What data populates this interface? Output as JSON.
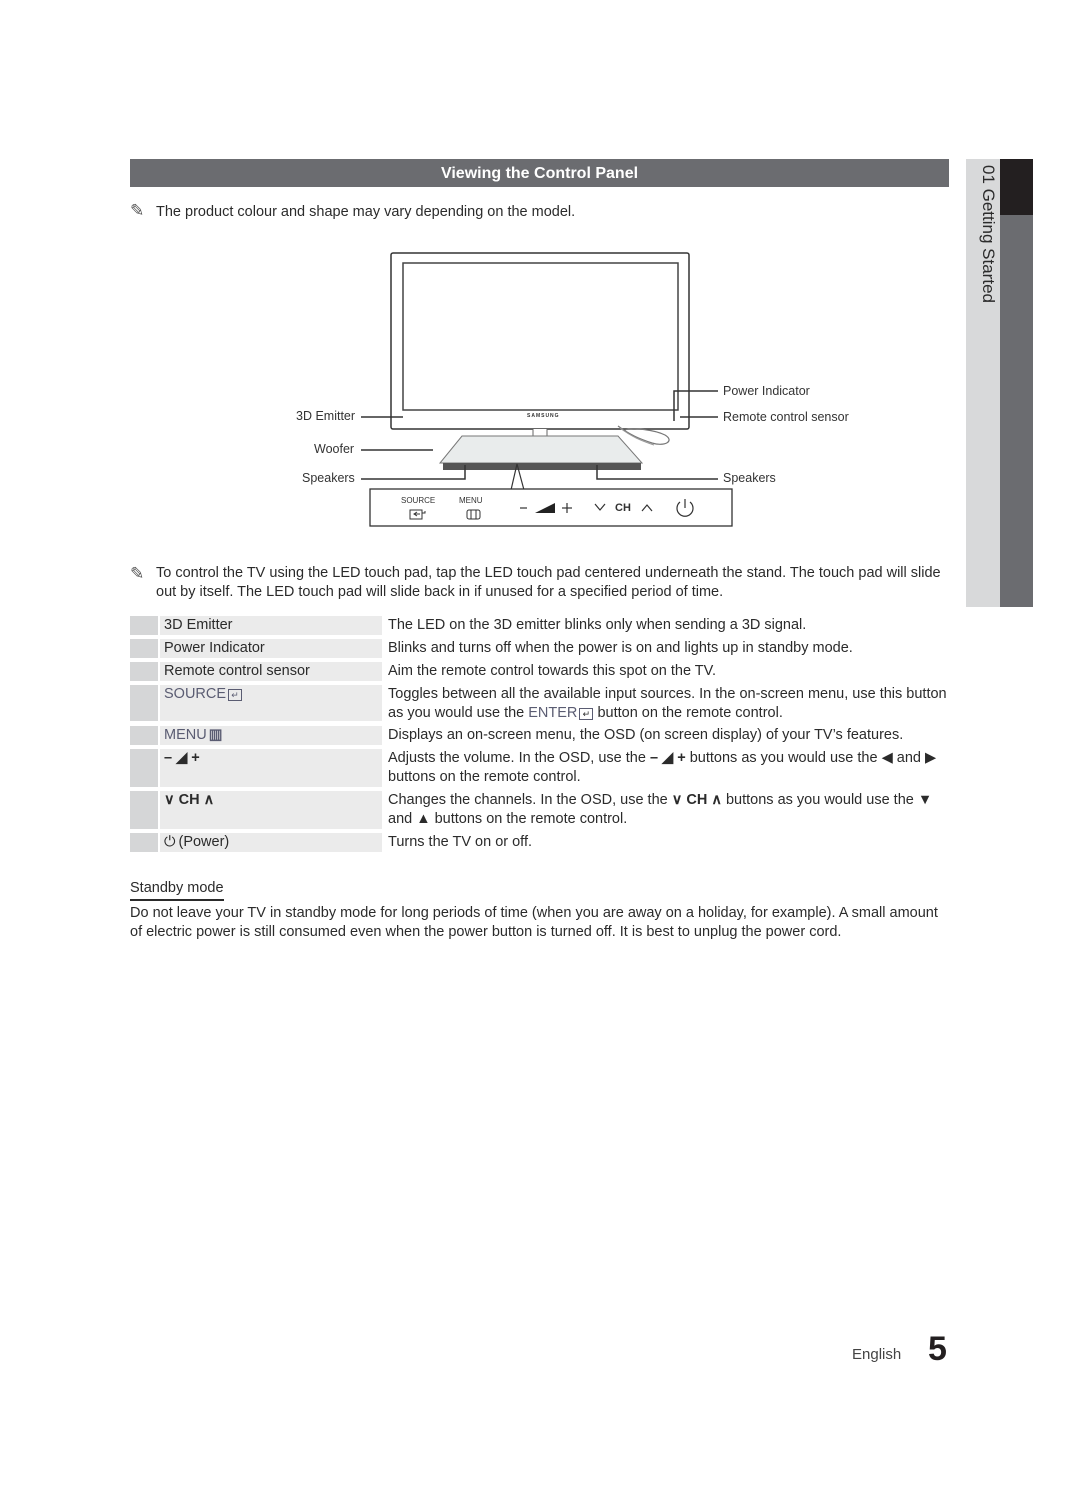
{
  "section": {
    "title": "Viewing the Control Panel"
  },
  "notes": {
    "colour_note": "The product colour and shape may vary depending on the model.",
    "touch_pad_note": "To control the TV using the LED touch pad, tap the LED touch pad centered underneath the stand. The touch pad will slide out by itself. The LED touch pad will slide back in if unused for a specified period of time.",
    "note_icon": "pencil-note-icon"
  },
  "diagram": {
    "labels": {
      "emitter_3d": "3D Emitter",
      "woofer": "Woofer",
      "speakers_left": "Speakers",
      "power_indicator": "Power Indicator",
      "remote_sensor": "Remote control sensor",
      "speakers_right": "Speakers",
      "brand": "SAMSUNG"
    },
    "touch_pad": {
      "source_label": "SOURCE",
      "menu_label": "MENU",
      "ch_label": "CH",
      "minus": "−",
      "plus": "+",
      "down": "∨",
      "up": "∧"
    }
  },
  "controls": [
    {
      "name": "3D Emitter",
      "description": "The LED on the 3D emitter blinks only when sending a 3D signal."
    },
    {
      "name": "Power Indicator",
      "description": "Blinks and turns off when the power is on and lights up in standby mode."
    },
    {
      "name": "Remote control sensor",
      "description": "Aim the remote control towards this spot on the TV."
    },
    {
      "name": "SOURCE",
      "description_a": "Toggles between all the available input sources. In the on-screen menu, use this button as you would use the ",
      "description_kw": "ENTER",
      "description_b": " button on the remote control."
    },
    {
      "name": "MENU",
      "description": "Displays an on-screen menu, the OSD (on screen display) of your TV’s features."
    },
    {
      "name": "– ◢ +",
      "description_a": "Adjusts the volume. In the OSD, use the ",
      "description_glyph": "– ◢ +",
      "description_b": " buttons as you would use the ◀ and ▶ buttons on the remote control."
    },
    {
      "name": "∨ CH ∧",
      "description_a": "Changes the channels. In the OSD, use the ",
      "description_glyph": "∨ CH ∧",
      "description_b": " buttons as you would use the ▼ and ▲ buttons on the remote control."
    },
    {
      "name": "(Power)",
      "description": "Turns the TV on or off."
    }
  ],
  "standby": {
    "title": "Standby mode",
    "body": "Do not leave your TV in standby mode for long periods of time (when you are away on a holiday, for example). A small amount of electric power is still consumed even when the power button is turned off. It is best to unplug the power cord."
  },
  "side_tab": {
    "chapter": "01  Getting Started"
  },
  "footer": {
    "language": "English",
    "page_number": "5"
  }
}
